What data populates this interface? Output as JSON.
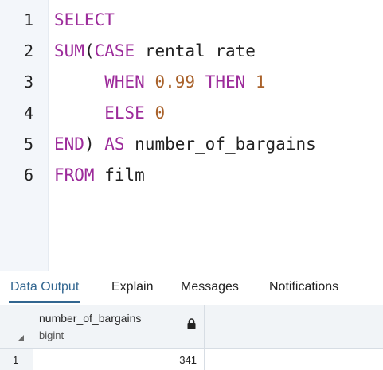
{
  "editor": {
    "lines": [
      {
        "n": "1",
        "tokens": [
          {
            "t": "SELECT",
            "c": "kw"
          }
        ]
      },
      {
        "n": "2",
        "tokens": [
          {
            "t": "SUM",
            "c": "kw"
          },
          {
            "t": "(",
            "c": "plain"
          },
          {
            "t": "CASE",
            "c": "kw"
          },
          {
            "t": " rental_rate",
            "c": "plain"
          }
        ]
      },
      {
        "n": "3",
        "tokens": [
          {
            "t": "     ",
            "c": "plain"
          },
          {
            "t": "WHEN",
            "c": "kw"
          },
          {
            "t": " ",
            "c": "plain"
          },
          {
            "t": "0.99",
            "c": "num"
          },
          {
            "t": " ",
            "c": "plain"
          },
          {
            "t": "THEN",
            "c": "kw"
          },
          {
            "t": " ",
            "c": "plain"
          },
          {
            "t": "1",
            "c": "num"
          }
        ]
      },
      {
        "n": "4",
        "tokens": [
          {
            "t": "     ",
            "c": "plain"
          },
          {
            "t": "ELSE",
            "c": "kw"
          },
          {
            "t": " ",
            "c": "plain"
          },
          {
            "t": "0",
            "c": "num"
          }
        ]
      },
      {
        "n": "5",
        "tokens": [
          {
            "t": "END",
            "c": "kw"
          },
          {
            "t": ") ",
            "c": "plain"
          },
          {
            "t": "AS",
            "c": "kw"
          },
          {
            "t": " number_of_bargains",
            "c": "plain"
          }
        ]
      },
      {
        "n": "6",
        "tokens": [
          {
            "t": "FROM",
            "c": "kw"
          },
          {
            "t": " film",
            "c": "plain"
          }
        ]
      }
    ]
  },
  "tabs": {
    "data_output": "Data Output",
    "explain": "Explain",
    "messages": "Messages",
    "notifications": "Notifications"
  },
  "grid": {
    "column_name": "number_of_bargains",
    "column_type": "bigint",
    "rows": [
      {
        "row": "1",
        "value": "341"
      }
    ]
  },
  "colors": {
    "keyword": "#9c2a9a",
    "number": "#a9622b",
    "active_tab": "#326690"
  }
}
